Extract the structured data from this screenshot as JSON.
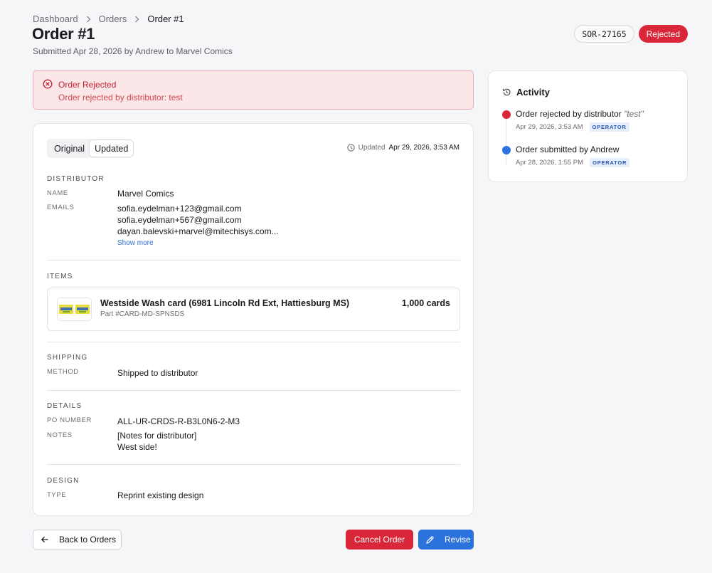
{
  "breadcrumb": {
    "items": [
      "Dashboard",
      "Orders",
      "Order #1"
    ]
  },
  "page": {
    "title": "Order #1",
    "subtitle": "Submitted Apr 28, 2026 by Andrew to Marvel Comics",
    "order_code": "SOR-27165",
    "status": "Rejected"
  },
  "alert": {
    "title": "Order Rejected",
    "message": "Order rejected by distributor: test"
  },
  "toggle": {
    "options": [
      "Original",
      "Updated"
    ],
    "selected": "Updated"
  },
  "updated": {
    "label": "Updated",
    "value": "Apr 29, 2026, 3:53 AM"
  },
  "distributor": {
    "heading": "Distributor",
    "name_label": "Name",
    "name": "Marvel Comics",
    "emails_label": "Emails",
    "emails": [
      "sofia.eydelman+123@gmail.com",
      "sofia.eydelman+567@gmail.com",
      "dayan.balevski+marvel@mitechisys.com..."
    ],
    "show_more": "Show more"
  },
  "items": {
    "heading": "Items",
    "list": [
      {
        "name": "Westside Wash card (6981 Lincoln Rd Ext, Hattiesburg MS)",
        "part": "Part #CARD-MD-SPNSDS",
        "quantity": "1,000 cards"
      }
    ]
  },
  "shipping": {
    "heading": "Shipping",
    "method_label": "Method",
    "method": "Shipped to distributor"
  },
  "details": {
    "heading": "Details",
    "po_label": "PO Number",
    "po_number": "ALL-UR-CRDS-R-B3L0N6-2-M3",
    "notes_label": "Notes",
    "notes": [
      "[Notes for distributor]",
      "West side!"
    ]
  },
  "design": {
    "heading": "Design",
    "type_label": "Type",
    "type": "Reprint existing design"
  },
  "activity": {
    "title": "Activity",
    "events": [
      {
        "text": "Order rejected by distributor",
        "quote": "\"test\"",
        "time": "Apr 29, 2026, 3:53 AM",
        "role": "OPERATOR",
        "color": "#d92638"
      },
      {
        "text": "Order submitted by Andrew",
        "quote": "",
        "time": "Apr 28, 2026, 1:55 PM",
        "role": "OPERATOR",
        "color": "#2b72dd"
      }
    ]
  },
  "buttons": {
    "back": "Back to Orders",
    "cancel": "Cancel Order",
    "revise": "Revise"
  },
  "icons": {
    "breadcrumb_sep": "chevron-right-icon",
    "alert": "x-circle-icon",
    "updated": "clock-icon",
    "activity": "history-icon",
    "back": "arrow-left-icon",
    "revise": "pencil-icon"
  },
  "colors": {
    "danger": "#d92638",
    "primary": "#2b72dd",
    "alert_bg": "#fbe6e8"
  }
}
